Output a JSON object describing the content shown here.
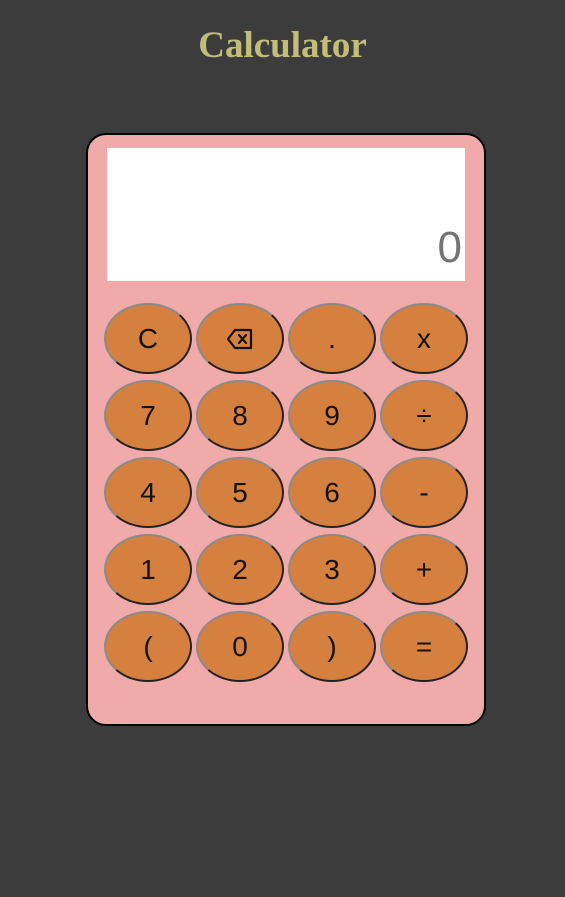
{
  "app": {
    "title": "Calculator"
  },
  "display": {
    "value": "0"
  },
  "keys": [
    {
      "label": "C"
    },
    {
      "label": "",
      "icon": "backspace-icon"
    },
    {
      "label": "."
    },
    {
      "label": "x"
    },
    {
      "label": "7"
    },
    {
      "label": "8"
    },
    {
      "label": "9"
    },
    {
      "label": "÷"
    },
    {
      "label": "4"
    },
    {
      "label": "5"
    },
    {
      "label": "6"
    },
    {
      "label": "-"
    },
    {
      "label": "1"
    },
    {
      "label": "2"
    },
    {
      "label": "3"
    },
    {
      "label": "+"
    },
    {
      "label": "("
    },
    {
      "label": "0"
    },
    {
      "label": ")"
    },
    {
      "label": "="
    }
  ],
  "colors": {
    "background": "#3c3c3c",
    "title": "#c2bd78",
    "calculator_body": "#f0aaaa",
    "display_bg": "#ffffff",
    "display_text": "#737373",
    "key_fill": "#d68040"
  }
}
